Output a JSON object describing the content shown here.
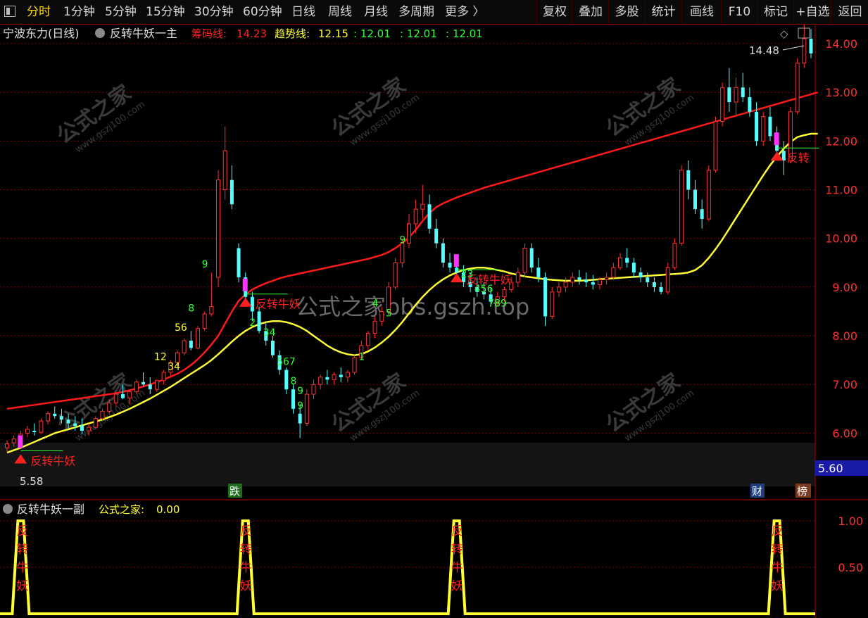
{
  "colors": {
    "up": "#ff3232",
    "down": "#54ffff",
    "ma_red": "#ff1a1a",
    "ma_yellow": "#ffff33",
    "grid": "#8a0000",
    "count": "#33ff33",
    "count_y": "#ffff33",
    "signal": "#ff2020",
    "magenta": "#ff33ff"
  },
  "toolbar": {
    "tabs": [
      {
        "label": "分时",
        "active": true
      },
      {
        "label": "1分钟"
      },
      {
        "label": "5分钟"
      },
      {
        "label": "15分钟"
      },
      {
        "label": "30分钟"
      },
      {
        "label": "60分钟"
      },
      {
        "label": "日线"
      },
      {
        "label": "周线"
      },
      {
        "label": "月线"
      },
      {
        "label": "多周期"
      },
      {
        "label": "更多 〉"
      }
    ],
    "buttons": [
      "复权",
      "叠加",
      "多股",
      "统计",
      "画线",
      "F10",
      "标记",
      "+自选",
      "返回"
    ]
  },
  "main_legend": {
    "stock": "宁波东力(日线)",
    "indicator": "反转牛妖一主",
    "chip_label": "筹码线:",
    "chip_value": "14.23",
    "trend_label": "趋势线:",
    "trend_value": "12.15",
    "v1": ": 12.01",
    "v2": ": 12.01",
    "v3": ": 12.01"
  },
  "sub_legend": {
    "indicator": "反转牛妖一副",
    "label": "公式之家:",
    "value": "0.00"
  },
  "watermark": {
    "center": "公式之家bbs.gszh.top",
    "tile_cn": "公式之家",
    "tile_url": "www.gszj100.com"
  },
  "annotations": {
    "high": "14.48",
    "low": "5.58",
    "signal_text": "反转牛妖",
    "signal_text_short": "反转",
    "current": "5.60",
    "badge_die": "跌",
    "badge_cai": "财",
    "badge_bang": "榜"
  },
  "chart_data": [
    {
      "type": "candlestick",
      "title": "宁波东力(日线)",
      "y_ticks": [
        6.0,
        7.0,
        8.0,
        9.0,
        10.0,
        11.0,
        12.0,
        13.0,
        14.0
      ],
      "ylim": [
        5.5,
        14.7
      ],
      "ohlc": [
        [
          5.7,
          5.85,
          5.62,
          5.78
        ],
        [
          5.8,
          5.95,
          5.72,
          5.88
        ],
        [
          5.88,
          6.05,
          5.8,
          5.98
        ],
        [
          6.0,
          6.15,
          5.92,
          6.08
        ],
        [
          6.05,
          6.2,
          5.95,
          6.02
        ],
        [
          6.02,
          6.3,
          5.98,
          6.25
        ],
        [
          6.25,
          6.45,
          6.18,
          6.4
        ],
        [
          6.4,
          6.55,
          6.3,
          6.35
        ],
        [
          6.35,
          6.5,
          6.2,
          6.28
        ],
        [
          6.28,
          6.4,
          6.1,
          6.2
        ],
        [
          6.2,
          6.35,
          6.05,
          6.15
        ],
        [
          6.15,
          6.3,
          5.98,
          6.05
        ],
        [
          6.05,
          6.2,
          5.95,
          6.12
        ],
        [
          6.12,
          6.35,
          6.08,
          6.3
        ],
        [
          6.3,
          6.5,
          6.25,
          6.45
        ],
        [
          6.45,
          6.7,
          6.4,
          6.62
        ],
        [
          6.62,
          6.85,
          6.55,
          6.8
        ],
        [
          6.8,
          7.0,
          6.7,
          6.72
        ],
        [
          6.72,
          6.9,
          6.6,
          6.85
        ],
        [
          6.85,
          7.1,
          6.8,
          7.05
        ],
        [
          7.05,
          7.25,
          6.95,
          7.0
        ],
        [
          7.0,
          7.15,
          6.8,
          6.9
        ],
        [
          6.9,
          7.1,
          6.85,
          7.08
        ],
        [
          7.08,
          7.3,
          7.0,
          7.25
        ],
        [
          7.25,
          7.5,
          7.18,
          7.45
        ],
        [
          7.45,
          7.7,
          7.38,
          7.65
        ],
        [
          7.65,
          7.95,
          7.6,
          7.9
        ],
        [
          7.9,
          8.1,
          7.7,
          7.75
        ],
        [
          7.75,
          8.2,
          7.72,
          8.15
        ],
        [
          8.15,
          8.5,
          8.1,
          8.45
        ],
        [
          8.45,
          9.3,
          8.4,
          8.6
        ],
        [
          9.2,
          11.4,
          9.0,
          11.2
        ],
        [
          11.0,
          12.3,
          10.8,
          11.8
        ],
        [
          11.2,
          11.5,
          10.6,
          10.7
        ],
        [
          9.8,
          9.9,
          9.1,
          9.2
        ],
        [
          9.2,
          9.3,
          8.7,
          8.8
        ],
        [
          8.8,
          8.9,
          8.3,
          8.5
        ],
        [
          8.5,
          8.6,
          8.05,
          8.1
        ],
        [
          8.1,
          8.3,
          7.8,
          7.9
        ],
        [
          7.9,
          8.0,
          7.55,
          7.6
        ],
        [
          7.6,
          7.7,
          7.2,
          7.3
        ],
        [
          7.3,
          7.35,
          6.8,
          6.9
        ],
        [
          6.9,
          7.0,
          6.4,
          6.5
        ],
        [
          6.4,
          6.6,
          5.9,
          6.2
        ],
        [
          6.2,
          6.9,
          6.15,
          6.8
        ],
        [
          6.8,
          7.1,
          6.7,
          7.0
        ],
        [
          7.0,
          7.2,
          6.9,
          7.15
        ],
        [
          7.15,
          7.3,
          7.0,
          7.1
        ],
        [
          7.1,
          7.25,
          7.0,
          7.2
        ],
        [
          7.2,
          7.35,
          7.05,
          7.15
        ],
        [
          7.15,
          7.3,
          7.05,
          7.25
        ],
        [
          7.25,
          7.6,
          7.2,
          7.55
        ],
        [
          7.55,
          7.9,
          7.5,
          7.8
        ],
        [
          7.8,
          8.1,
          7.7,
          8.05
        ],
        [
          8.05,
          8.4,
          7.95,
          8.3
        ],
        [
          8.3,
          8.6,
          8.2,
          8.5
        ],
        [
          8.5,
          9.1,
          8.45,
          9.0
        ],
        [
          9.0,
          9.6,
          8.95,
          9.5
        ],
        [
          9.5,
          10.0,
          9.4,
          9.9
        ],
        [
          9.9,
          10.5,
          9.8,
          10.3
        ],
        [
          10.3,
          10.8,
          10.1,
          10.6
        ],
        [
          10.6,
          11.1,
          10.4,
          10.7
        ],
        [
          10.7,
          10.9,
          10.1,
          10.2
        ],
        [
          10.2,
          10.4,
          9.8,
          9.9
        ],
        [
          9.9,
          10.0,
          9.4,
          9.5
        ],
        [
          9.5,
          9.7,
          9.3,
          9.4
        ],
        [
          9.4,
          9.6,
          9.2,
          9.3
        ],
        [
          9.3,
          9.45,
          9.0,
          9.1
        ],
        [
          9.1,
          9.3,
          8.9,
          9.0
        ],
        [
          9.0,
          9.2,
          8.8,
          8.9
        ],
        [
          8.9,
          9.1,
          8.75,
          8.85
        ],
        [
          8.85,
          9.0,
          8.6,
          8.7
        ],
        [
          8.7,
          8.9,
          8.6,
          8.8
        ],
        [
          8.8,
          9.0,
          8.7,
          8.95
        ],
        [
          8.95,
          9.2,
          8.9,
          9.1
        ],
        [
          9.1,
          9.4,
          9.0,
          9.3
        ],
        [
          9.3,
          9.9,
          9.2,
          9.8
        ],
        [
          9.8,
          9.9,
          9.3,
          9.4
        ],
        [
          9.4,
          9.6,
          9.1,
          9.2
        ],
        [
          9.2,
          9.3,
          8.2,
          8.4
        ],
        [
          8.4,
          9.0,
          8.35,
          8.9
        ],
        [
          8.9,
          9.1,
          8.8,
          9.0
        ],
        [
          9.0,
          9.2,
          8.9,
          9.1
        ],
        [
          9.1,
          9.3,
          9.0,
          9.2
        ],
        [
          9.2,
          9.35,
          9.05,
          9.15
        ],
        [
          9.15,
          9.3,
          9.0,
          9.1
        ],
        [
          9.1,
          9.25,
          8.95,
          9.05
        ],
        [
          9.05,
          9.2,
          8.95,
          9.15
        ],
        [
          9.15,
          9.3,
          9.05,
          9.2
        ],
        [
          9.2,
          9.5,
          9.15,
          9.4
        ],
        [
          9.4,
          9.7,
          9.35,
          9.6
        ],
        [
          9.6,
          9.8,
          9.4,
          9.5
        ],
        [
          9.5,
          9.6,
          9.2,
          9.3
        ],
        [
          9.3,
          9.4,
          9.1,
          9.2
        ],
        [
          9.2,
          9.3,
          9.0,
          9.1
        ],
        [
          9.1,
          9.2,
          8.9,
          9.0
        ],
        [
          9.0,
          9.1,
          8.85,
          8.9
        ],
        [
          8.9,
          9.5,
          8.85,
          9.4
        ],
        [
          9.4,
          10.0,
          9.35,
          9.9
        ],
        [
          9.9,
          11.5,
          9.85,
          11.4
        ],
        [
          11.4,
          11.6,
          10.8,
          11.0
        ],
        [
          11.0,
          11.2,
          10.5,
          10.6
        ],
        [
          10.6,
          10.8,
          10.2,
          10.4
        ],
        [
          10.4,
          11.5,
          10.35,
          11.4
        ],
        [
          11.4,
          12.5,
          11.35,
          12.4
        ],
        [
          12.4,
          13.2,
          12.3,
          13.1
        ],
        [
          13.1,
          13.5,
          12.6,
          12.8
        ],
        [
          12.8,
          13.3,
          12.5,
          13.1
        ],
        [
          13.1,
          13.4,
          12.8,
          12.9
        ],
        [
          12.9,
          13.1,
          12.5,
          12.6
        ],
        [
          12.6,
          12.8,
          11.9,
          12.0
        ],
        [
          12.0,
          12.6,
          11.9,
          12.5
        ],
        [
          12.5,
          12.7,
          12.0,
          12.1
        ],
        [
          12.1,
          12.3,
          11.7,
          11.8
        ],
        [
          11.8,
          12.0,
          11.3,
          11.6
        ],
        [
          11.6,
          12.7,
          11.55,
          12.6
        ],
        [
          12.6,
          13.7,
          12.55,
          13.6
        ],
        [
          13.6,
          14.48,
          13.5,
          14.1
        ],
        [
          14.1,
          14.3,
          13.7,
          13.8
        ]
      ],
      "ma_red": [
        6.5,
        6.52,
        6.54,
        6.56,
        6.58,
        6.6,
        6.62,
        6.64,
        6.66,
        6.68,
        6.7,
        6.72,
        6.74,
        6.76,
        6.78,
        6.8,
        6.82,
        6.85,
        6.88,
        6.92,
        6.96,
        7.0,
        7.05,
        7.1,
        7.16,
        7.22,
        7.3,
        7.4,
        7.52,
        7.66,
        7.82,
        8.0,
        8.25,
        8.5,
        8.72,
        8.85,
        8.95,
        9.02,
        9.08,
        9.13,
        9.18,
        9.22,
        9.25,
        9.28,
        9.31,
        9.34,
        9.37,
        9.4,
        9.43,
        9.46,
        9.49,
        9.52,
        9.55,
        9.58,
        9.62,
        9.66,
        9.72,
        9.8,
        9.9,
        10.02,
        10.18,
        10.36,
        10.52,
        10.64,
        10.72,
        10.78,
        10.84,
        10.89,
        10.94,
        10.99,
        11.04,
        11.08,
        11.12,
        11.16,
        11.2,
        11.24,
        11.28,
        11.32,
        11.36,
        11.4,
        11.44,
        11.48,
        11.52,
        11.56,
        11.6,
        11.64,
        11.68,
        11.72,
        11.76,
        11.8,
        11.84,
        11.88,
        11.92,
        11.96,
        12.0,
        12.04,
        12.08,
        12.12,
        12.16,
        12.2,
        12.24,
        12.28,
        12.32,
        12.36,
        12.4,
        12.44,
        12.48,
        12.52,
        12.56,
        12.6,
        12.64,
        12.68,
        12.72,
        12.76,
        12.8,
        12.84,
        12.88,
        12.92,
        12.96,
        13.0
      ],
      "ma_yellow": [
        5.6,
        5.65,
        5.7,
        5.76,
        5.82,
        5.88,
        5.94,
        6.0,
        6.04,
        6.08,
        6.12,
        6.16,
        6.2,
        6.24,
        6.28,
        6.33,
        6.38,
        6.44,
        6.5,
        6.57,
        6.64,
        6.71,
        6.79,
        6.87,
        6.95,
        7.04,
        7.13,
        7.22,
        7.31,
        7.4,
        7.5,
        7.62,
        7.75,
        7.88,
        8.0,
        8.1,
        8.18,
        8.24,
        8.28,
        8.3,
        8.3,
        8.28,
        8.24,
        8.18,
        8.1,
        8.0,
        7.9,
        7.8,
        7.72,
        7.66,
        7.62,
        7.6,
        7.62,
        7.68,
        7.76,
        7.86,
        7.98,
        8.12,
        8.28,
        8.46,
        8.64,
        8.8,
        8.94,
        9.06,
        9.16,
        9.24,
        9.3,
        9.35,
        9.38,
        9.4,
        9.4,
        9.38,
        9.35,
        9.32,
        9.28,
        9.25,
        9.22,
        9.2,
        9.18,
        9.16,
        9.15,
        9.14,
        9.13,
        9.13,
        9.13,
        9.14,
        9.15,
        9.16,
        9.17,
        9.18,
        9.19,
        9.2,
        9.21,
        9.22,
        9.23,
        9.24,
        9.25,
        9.26,
        9.27,
        9.28,
        9.3,
        9.35,
        9.45,
        9.6,
        9.78,
        9.98,
        10.2,
        10.42,
        10.64,
        10.86,
        11.08,
        11.3,
        11.5,
        11.68,
        11.84,
        11.98,
        12.08,
        12.12,
        12.15,
        12.15
      ],
      "signals": [
        {
          "index": 2,
          "price": 5.58
        },
        {
          "index": 35,
          "price": 8.8
        },
        {
          "index": 66,
          "price": 9.3
        },
        {
          "index": 113,
          "price": 11.8
        }
      ],
      "counts": [
        {
          "index": 29,
          "price": 9.4,
          "t": "9"
        },
        {
          "index": 27,
          "price": 8.5,
          "t": "8"
        },
        {
          "index": 25,
          "price": 8.1,
          "t": "56"
        },
        {
          "index": 22,
          "price": 7.5,
          "t": "12"
        },
        {
          "index": 24,
          "price": 7.3,
          "t": "34"
        },
        {
          "index": 36,
          "price": 8.2,
          "t": "2"
        },
        {
          "index": 38,
          "price": 8.0,
          "t": "34"
        },
        {
          "index": 40,
          "price": 7.4,
          "t": "567"
        },
        {
          "index": 42,
          "price": 7.0,
          "t": "8"
        },
        {
          "index": 43,
          "price": 6.8,
          "t": "9"
        },
        {
          "index": 43,
          "price": 6.5,
          "t": "9"
        },
        {
          "index": 54,
          "price": 8.6,
          "t": "4"
        },
        {
          "index": 56,
          "price": 8.4,
          "t": "5"
        },
        {
          "index": 58,
          "price": 9.9,
          "t": "9"
        },
        {
          "index": 52,
          "price": 7.5,
          "t": "1"
        },
        {
          "index": 67,
          "price": 9.2,
          "t": "23"
        },
        {
          "index": 69,
          "price": 8.9,
          "t": "456"
        },
        {
          "index": 71,
          "price": 8.6,
          "t": "789"
        }
      ],
      "ma_labels": {
        "chip": "筹码线",
        "trend": "趋势线"
      }
    },
    {
      "type": "line",
      "title": "反转牛妖一副",
      "y_ticks": [
        0.5,
        1.0
      ],
      "ylim": [
        0,
        1.2
      ],
      "values_peaks": [
        2,
        35,
        66,
        113
      ],
      "vertical_text": [
        "反",
        "转",
        "牛",
        "妖"
      ]
    }
  ]
}
